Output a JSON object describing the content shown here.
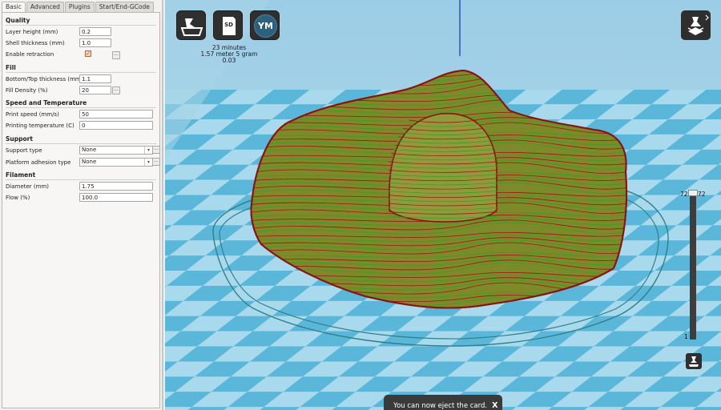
{
  "tabs": [
    "Basic",
    "Advanced",
    "Plugins",
    "Start/End-GCode"
  ],
  "sections": {
    "quality": "Quality",
    "fill": "Fill",
    "speed": "Speed and Temperature",
    "support": "Support",
    "filament": "Filament"
  },
  "fields": {
    "layer_height": {
      "label": "Layer height (mm)",
      "value": "0.2"
    },
    "shell_thickness": {
      "label": "Shell thickness (mm)",
      "value": "1.0"
    },
    "enable_retraction": {
      "label": "Enable retraction",
      "checked": true
    },
    "bottom_top": {
      "label": "Bottom/Top thickness (mm)",
      "value": "1.1"
    },
    "fill_density": {
      "label": "Fill Density (%)",
      "value": "20"
    },
    "print_speed": {
      "label": "Print speed (mm/s)",
      "value": "50"
    },
    "print_temp": {
      "label": "Printing temperature (C)",
      "value": "0"
    },
    "support_type": {
      "label": "Support type",
      "value": "None"
    },
    "platform_adhesion": {
      "label": "Platform adhesion type",
      "value": "None"
    },
    "diameter": {
      "label": "Diameter (mm)",
      "value": "1.75"
    },
    "flow": {
      "label": "Flow (%)",
      "value": "100.0"
    }
  },
  "dots_label": "...",
  "toolbar": {
    "sd_label": "SD",
    "ym_label": "YM"
  },
  "print_info": {
    "time": "23 minutes",
    "material": "1.57 meter 5 gram",
    "cost": "0.03"
  },
  "layer_view": {
    "top_left": "72",
    "top_right": "72",
    "bottom": "1"
  },
  "toast": {
    "message": "You can now eject the card.",
    "close": "X"
  },
  "colors": {
    "floor_light": "#a9d9ec",
    "floor_dark": "#5bb7da",
    "wall_red": "#a01414",
    "infill_green": "#3f9a2a",
    "skirt": "#2f7f86"
  }
}
